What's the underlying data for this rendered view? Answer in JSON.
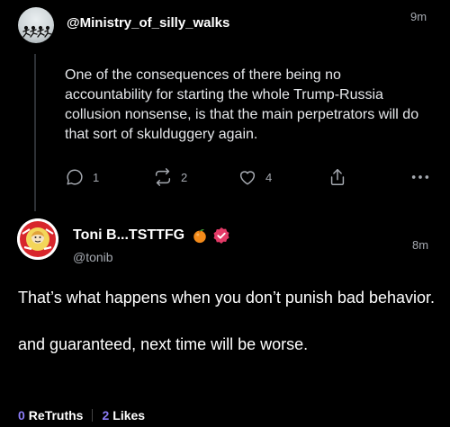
{
  "parent_post": {
    "handle": "@Ministry_of_silly_walks",
    "time": "9m",
    "body": "One of the consequences of there being no accountability for starting the whole Trump-Russia collusion nonsense, is that the main perpetrators will do that sort of skulduggery again.",
    "actions": {
      "reply_count": "1",
      "retruth_count": "2",
      "like_count": "4"
    }
  },
  "reply_post": {
    "display_name": "Toni B...TSTTFG",
    "handle": "@tonib",
    "time": "8m",
    "paragraph_1": "That’s what happens when you don’t punish bad behavior.",
    "paragraph_2": "and guaranteed, next time will be worse.",
    "stats": {
      "retruths_count": "0",
      "retruths_label": "ReTruths",
      "likes_count": "2",
      "likes_label": "Likes"
    }
  },
  "colors": {
    "background": "#000000",
    "muted": "#a5a9b0",
    "accent": "#8b7cf6",
    "verified": "#e33a67"
  },
  "icons": [
    "reply-icon",
    "retruth-icon",
    "heart-icon",
    "share-icon",
    "more-icon",
    "orange-emoji-icon",
    "verified-badge-icon"
  ]
}
